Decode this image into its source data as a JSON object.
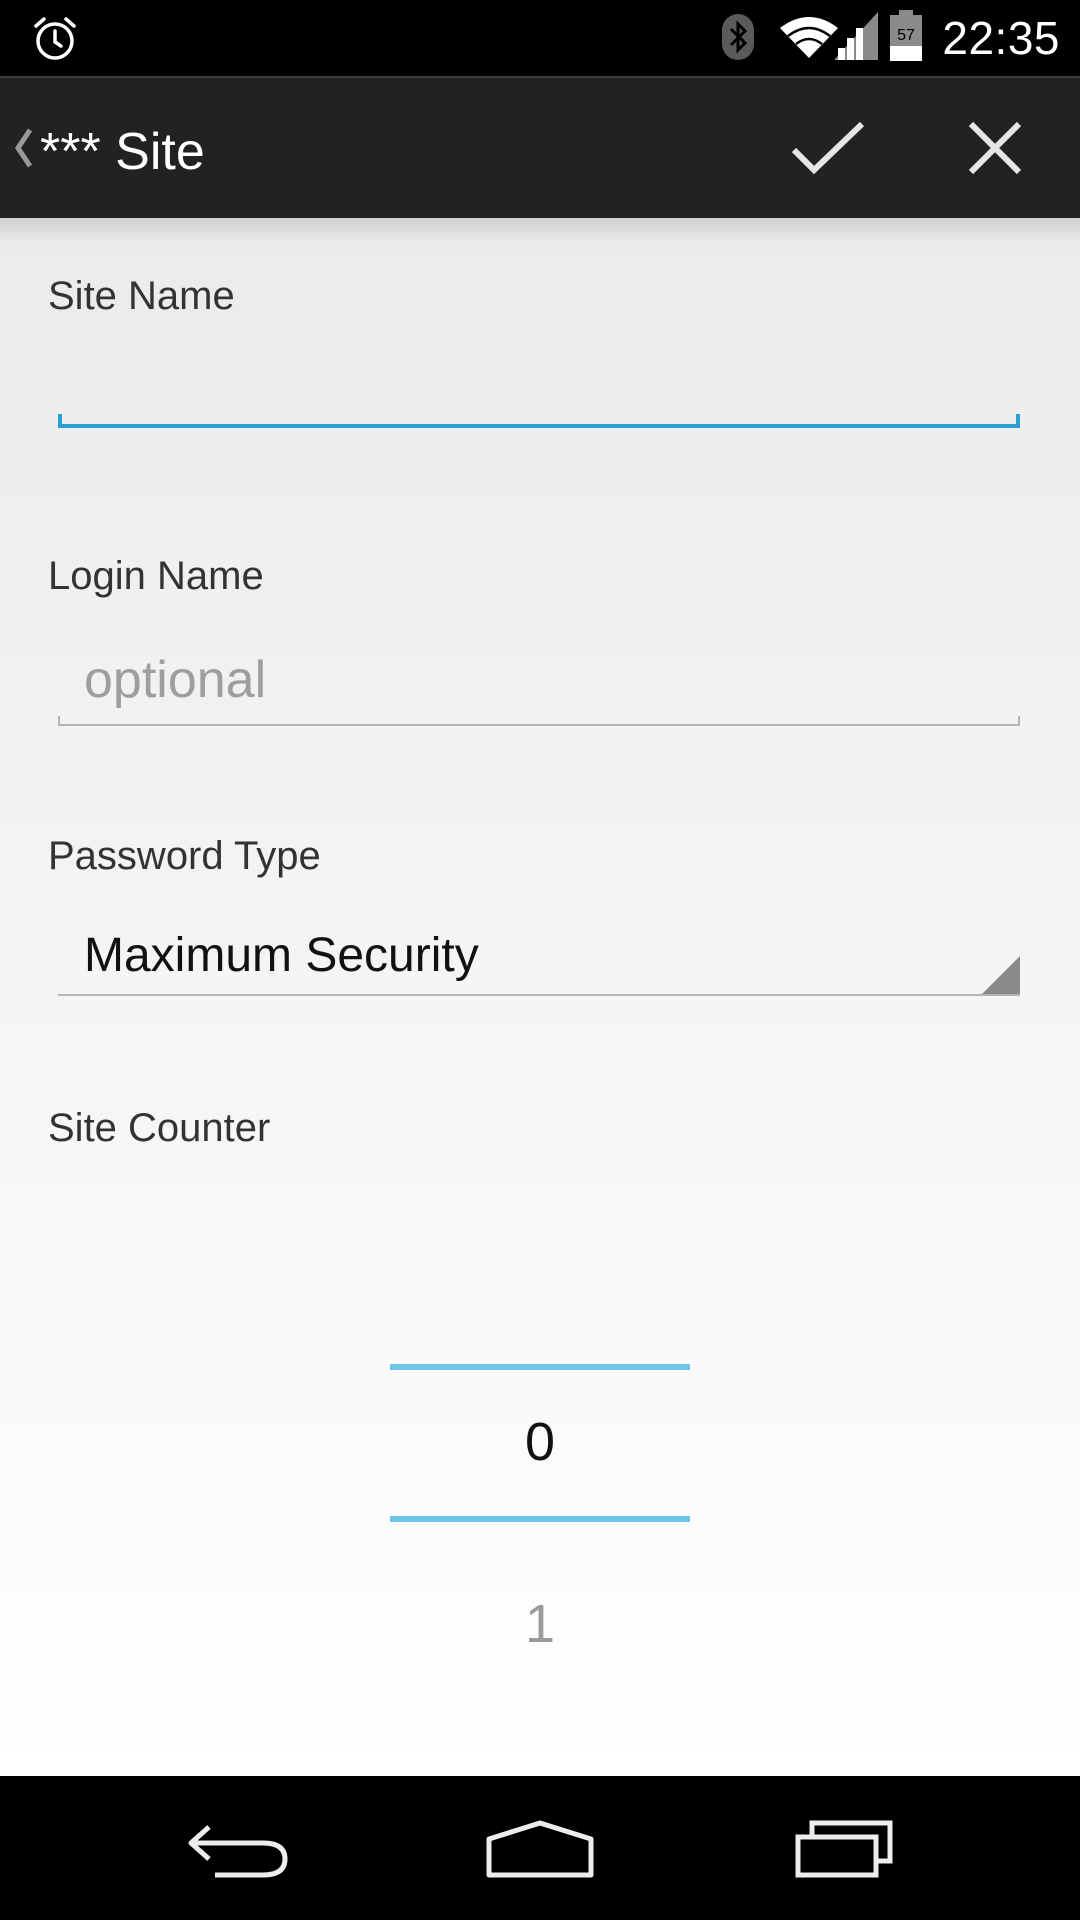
{
  "status_bar": {
    "time": "22:35",
    "battery_level": "57",
    "icons": [
      "alarm-icon",
      "bluetooth-icon",
      "wifi-icon",
      "cell-signal-icon",
      "battery-icon"
    ]
  },
  "action_bar": {
    "title": "*** Site",
    "up_icon": "chevron-left-icon",
    "done_icon": "check-icon",
    "cancel_icon": "close-icon"
  },
  "form": {
    "site_name": {
      "label": "Site Name",
      "value": "",
      "placeholder": ""
    },
    "login_name": {
      "label": "Login Name",
      "value": "",
      "placeholder": "optional"
    },
    "password_type": {
      "label": "Password Type",
      "selected": "Maximum Security"
    },
    "site_counter": {
      "label": "Site Counter",
      "current": "0",
      "next": "1"
    }
  },
  "colors": {
    "accent": "#2b9fd1",
    "picker_divider": "#6ec5e8",
    "action_bar": "#222222"
  },
  "nav_bar": {
    "icons": [
      "back-icon",
      "home-icon",
      "recent-apps-icon"
    ]
  }
}
